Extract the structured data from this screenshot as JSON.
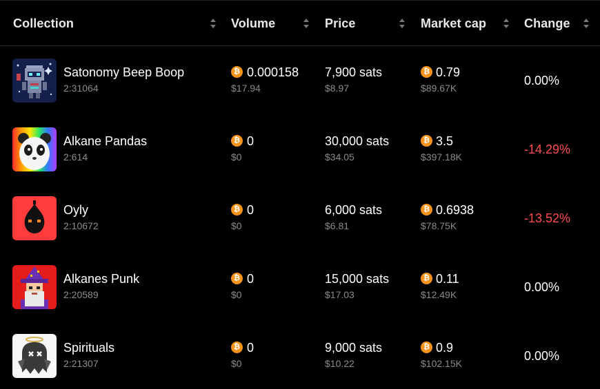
{
  "columns": {
    "collection": "Collection",
    "volume": "Volume",
    "price": "Price",
    "market_cap": "Market cap",
    "change": "Change"
  },
  "colors": {
    "negative": "#ff4d4f",
    "neutral": "#ffffff",
    "btc": "#f7931a"
  },
  "rows": [
    {
      "name": "Satonomy Beep Boop",
      "id": "2:31064",
      "volume_btc": "0.000158",
      "volume_usd": "$17.94",
      "price_sats": "7,900 sats",
      "price_usd": "$8.97",
      "mcap_btc": "0.79",
      "mcap_usd": "$89.67K",
      "change": "0.00%",
      "icon": "robot-avatar-icon"
    },
    {
      "name": "Alkane Pandas",
      "id": "2:614",
      "volume_btc": "0",
      "volume_usd": "$0",
      "price_sats": "30,000 sats",
      "price_usd": "$34.05",
      "mcap_btc": "3.5",
      "mcap_usd": "$397.18K",
      "change": "-14.29%",
      "icon": "panda-avatar-icon"
    },
    {
      "name": "Oyly",
      "id": "2:10672",
      "volume_btc": "0",
      "volume_usd": "$0",
      "price_sats": "6,000 sats",
      "price_usd": "$6.81",
      "mcap_btc": "0.6938",
      "mcap_usd": "$78.75K",
      "change": "-13.52%",
      "icon": "oil-drop-avatar-icon"
    },
    {
      "name": "Alkanes Punk",
      "id": "2:20589",
      "volume_btc": "0",
      "volume_usd": "$0",
      "price_sats": "15,000 sats",
      "price_usd": "$17.03",
      "mcap_btc": "0.11",
      "mcap_usd": "$12.49K",
      "change": "0.00%",
      "icon": "wizard-punk-avatar-icon"
    },
    {
      "name": "Spirituals",
      "id": "2:21307",
      "volume_btc": "0",
      "volume_usd": "$0",
      "price_sats": "9,000 sats",
      "price_usd": "$10.22",
      "mcap_btc": "0.9",
      "mcap_usd": "$102.15K",
      "change": "0.00%",
      "icon": "ghost-avatar-icon"
    }
  ]
}
